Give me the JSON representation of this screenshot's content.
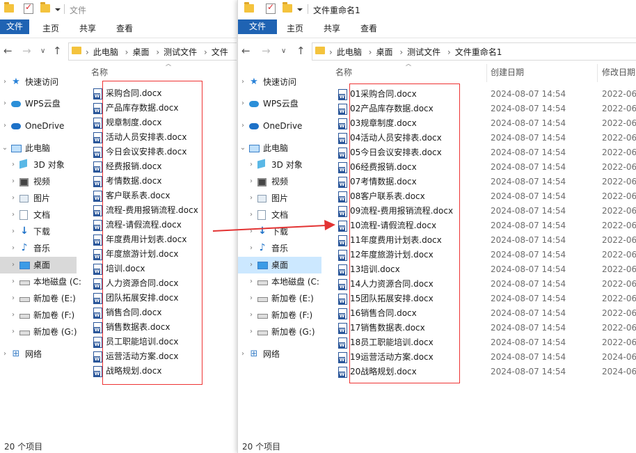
{
  "left": {
    "title": "文件",
    "ribbon_tabs": [
      "文件",
      "主页",
      "共享",
      "查看"
    ],
    "breadcrumb": [
      "此电脑",
      "桌面",
      "测试文件",
      "文件"
    ],
    "nav": [
      {
        "label": "快速访问",
        "icon": "star-icon"
      },
      {
        "label": "WPS云盘",
        "icon": "cloud-icon"
      },
      {
        "label": "OneDrive",
        "icon": "onedrive-icon"
      },
      {
        "label": "此电脑",
        "icon": "computer-icon"
      },
      {
        "label": "3D 对象",
        "icon": "3d-objects-icon"
      },
      {
        "label": "视频",
        "icon": "video-icon"
      },
      {
        "label": "图片",
        "icon": "picture-icon"
      },
      {
        "label": "文档",
        "icon": "document-icon"
      },
      {
        "label": "下载",
        "icon": "download-icon"
      },
      {
        "label": "音乐",
        "icon": "music-icon"
      },
      {
        "label": "桌面",
        "icon": "desktop-icon"
      },
      {
        "label": "本地磁盘 (C:",
        "icon": "drive-icon"
      },
      {
        "label": "新加卷 (E:)",
        "icon": "drive-icon"
      },
      {
        "label": "新加卷 (F:)",
        "icon": "drive-icon"
      },
      {
        "label": "新加卷 (G:)",
        "icon": "drive-icon"
      },
      {
        "label": "网络",
        "icon": "network-icon"
      }
    ],
    "column_name": "名称",
    "files": [
      "采购合同.docx",
      "产品库存数据.docx",
      "规章制度.docx",
      "活动人员安排表.docx",
      "今日会议安排表.docx",
      "经费报销.docx",
      "考情数据.docx",
      "客户联系表.docx",
      "流程-费用报销流程.docx",
      "流程-请假流程.docx",
      "年度费用计划表.docx",
      "年度旅游计划.docx",
      "培训.docx",
      "人力资源合同.docx",
      "团队拓展安排.docx",
      "销售合同.docx",
      "销售数据表.docx",
      "员工职能培训.docx",
      "运营活动方案.docx",
      "战略规划.docx"
    ],
    "status": "20 个项目"
  },
  "right": {
    "title": "文件重命名1",
    "ribbon_tabs": [
      "文件",
      "主页",
      "共享",
      "查看"
    ],
    "breadcrumb": [
      "此电脑",
      "桌面",
      "测试文件",
      "文件重命名1"
    ],
    "nav": [
      {
        "label": "快速访问",
        "icon": "star-icon"
      },
      {
        "label": "WPS云盘",
        "icon": "cloud-icon"
      },
      {
        "label": "OneDrive",
        "icon": "onedrive-icon"
      },
      {
        "label": "此电脑",
        "icon": "computer-icon"
      },
      {
        "label": "3D 对象",
        "icon": "3d-objects-icon"
      },
      {
        "label": "视频",
        "icon": "video-icon"
      },
      {
        "label": "图片",
        "icon": "picture-icon"
      },
      {
        "label": "文档",
        "icon": "document-icon"
      },
      {
        "label": "下载",
        "icon": "download-icon"
      },
      {
        "label": "音乐",
        "icon": "music-icon"
      },
      {
        "label": "桌面",
        "icon": "desktop-icon"
      },
      {
        "label": "本地磁盘 (C:",
        "icon": "drive-icon"
      },
      {
        "label": "新加卷 (E:)",
        "icon": "drive-icon"
      },
      {
        "label": "新加卷 (F:)",
        "icon": "drive-icon"
      },
      {
        "label": "新加卷 (G:)",
        "icon": "drive-icon"
      },
      {
        "label": "网络",
        "icon": "network-icon"
      }
    ],
    "columns": [
      "名称",
      "创建日期",
      "修改日期"
    ],
    "files": [
      {
        "name": "01采购合同.docx",
        "created": "2024-08-07 14:54",
        "modified": "2022-06-"
      },
      {
        "name": "02产品库存数据.docx",
        "created": "2024-08-07 14:54",
        "modified": "2022-06-"
      },
      {
        "name": "03规章制度.docx",
        "created": "2024-08-07 14:54",
        "modified": "2022-06-"
      },
      {
        "name": "04活动人员安排表.docx",
        "created": "2024-08-07 14:54",
        "modified": "2022-06-"
      },
      {
        "name": "05今日会议安排表.docx",
        "created": "2024-08-07 14:54",
        "modified": "2022-06-"
      },
      {
        "name": "06经费报销.docx",
        "created": "2024-08-07 14:54",
        "modified": "2022-06-"
      },
      {
        "name": "07考情数据.docx",
        "created": "2024-08-07 14:54",
        "modified": "2022-06-"
      },
      {
        "name": "08客户联系表.docx",
        "created": "2024-08-07 14:54",
        "modified": "2022-06-"
      },
      {
        "name": "09流程-费用报销流程.docx",
        "created": "2024-08-07 14:54",
        "modified": "2022-06-"
      },
      {
        "name": "10流程-请假流程.docx",
        "created": "2024-08-07 14:54",
        "modified": "2022-06-"
      },
      {
        "name": "11年度费用计划表.docx",
        "created": "2024-08-07 14:54",
        "modified": "2022-06-"
      },
      {
        "name": "12年度旅游计划.docx",
        "created": "2024-08-07 14:54",
        "modified": "2022-06-"
      },
      {
        "name": "13培训.docx",
        "created": "2024-08-07 14:54",
        "modified": "2022-06-"
      },
      {
        "name": "14人力资源合同.docx",
        "created": "2024-08-07 14:54",
        "modified": "2022-06-"
      },
      {
        "name": "15团队拓展安排.docx",
        "created": "2024-08-07 14:54",
        "modified": "2022-06-"
      },
      {
        "name": "16销售合同.docx",
        "created": "2024-08-07 14:54",
        "modified": "2022-06-"
      },
      {
        "name": "17销售数据表.docx",
        "created": "2024-08-07 14:54",
        "modified": "2022-06-"
      },
      {
        "name": "18员工职能培训.docx",
        "created": "2024-08-07 14:54",
        "modified": "2022-06-"
      },
      {
        "name": "19运营活动方案.docx",
        "created": "2024-08-07 14:54",
        "modified": "2024-06-"
      },
      {
        "name": "20战略规划.docx",
        "created": "2024-08-07 14:54",
        "modified": "2024-06-"
      }
    ],
    "status": "20 个项目"
  },
  "colors": {
    "accent": "#1f63b3",
    "highlight": "#e33333",
    "selected_nav": "#cce8ff"
  }
}
